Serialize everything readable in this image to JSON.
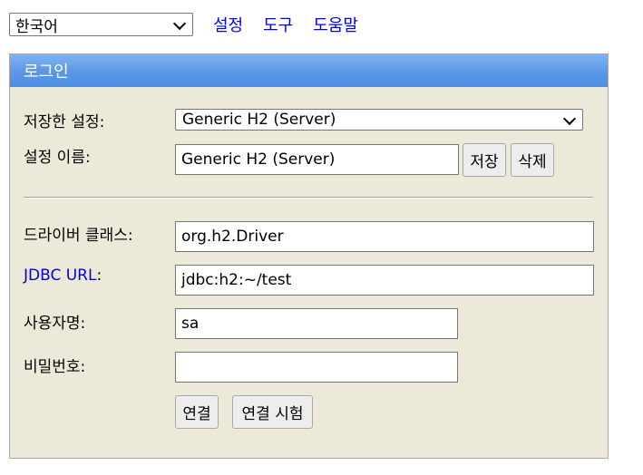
{
  "topbar": {
    "language_selected": "한국어",
    "links": [
      "설정",
      "도구",
      "도움말"
    ]
  },
  "panel": {
    "title": "로그인",
    "saved_settings_label": "저장한 설정:",
    "saved_settings_value": "Generic H2 (Server)",
    "setting_name_label": "설정 이름:",
    "setting_name_value": "Generic H2 (Server)",
    "save_button": "저장",
    "delete_button": "삭제",
    "driver_class_label": "드라이버 클래스:",
    "driver_class_value": "org.h2.Driver",
    "jdbc_url_link": "JDBC URL",
    "jdbc_url_colon": ":",
    "jdbc_url_value": "jdbc:h2:~/test",
    "username_label": "사용자명:",
    "username_value": "sa",
    "password_label": "비밀번호:",
    "password_value": "",
    "connect_button": "연결",
    "test_connection_button": "연결 시험"
  },
  "colors": {
    "panel_background": "#ece9d8",
    "header_blue": "#5b97e6",
    "link_blue": "#0000ee"
  }
}
